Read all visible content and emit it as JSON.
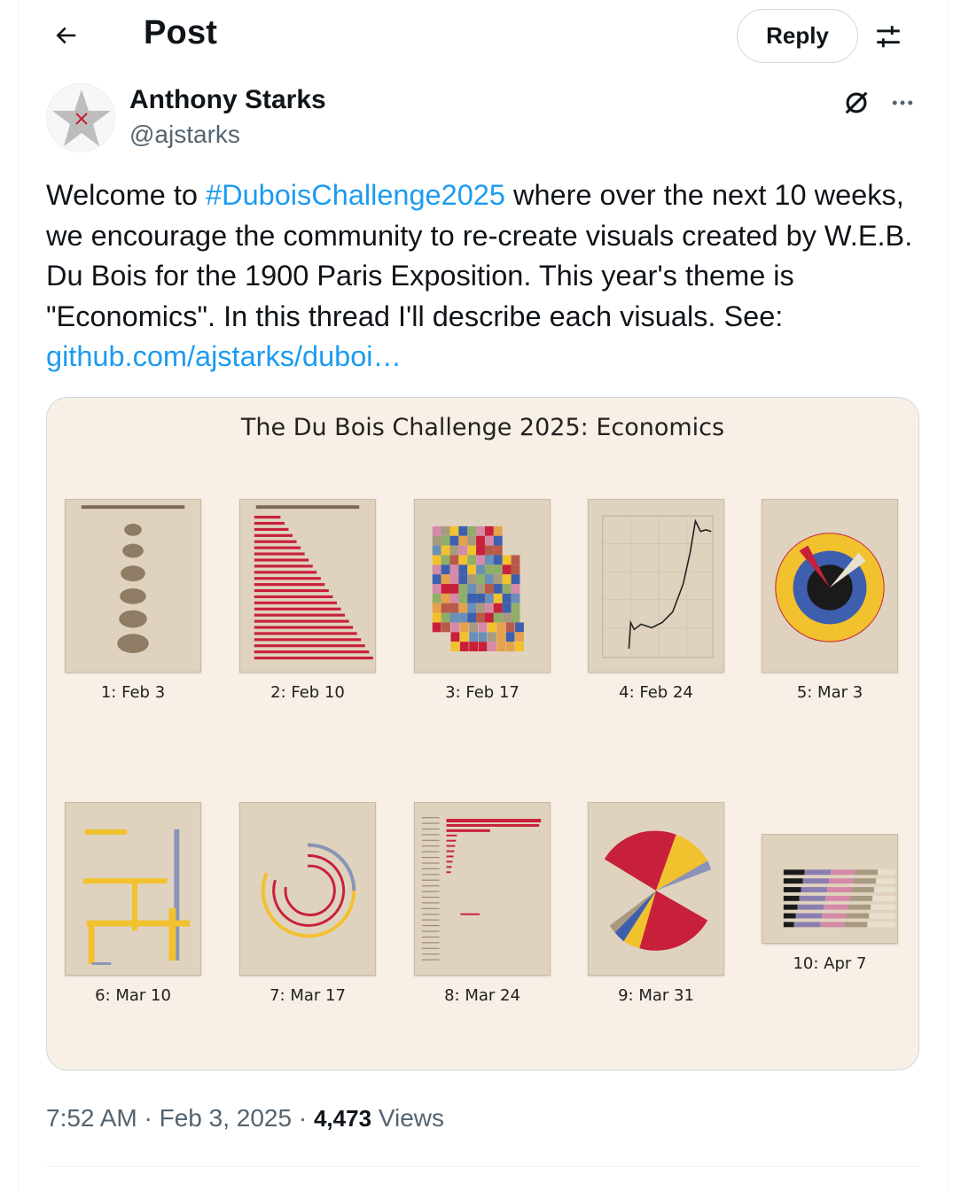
{
  "header": {
    "title": "Post",
    "reply_label": "Reply"
  },
  "author": {
    "name": "Anthony Starks",
    "handle": "@ajstarks"
  },
  "tweet": {
    "text_1": "Welcome to ",
    "hashtag": "#DuboisChallenge2025",
    "text_2": " where over the next 10 weeks, we encourage the community to re-create  visuals created by W.E.B. Du Bois for the 1900 Paris Exposition. This year's theme is \"Economics\".  In this thread I'll describe each visuals.  See: ",
    "link": "github.com/ajstarks/duboi…"
  },
  "media": {
    "title": "The Du Bois Challenge 2025: Economics",
    "thumbnails": [
      {
        "caption": "1: Feb 3"
      },
      {
        "caption": "2: Feb 10"
      },
      {
        "caption": "3: Feb 17"
      },
      {
        "caption": "4: Feb 24"
      },
      {
        "caption": "5: Mar 3"
      },
      {
        "caption": "6: Mar 10"
      },
      {
        "caption": "7: Mar 17"
      },
      {
        "caption": "8: Mar 24"
      },
      {
        "caption": "9: Mar 31"
      },
      {
        "caption": "10: Apr 7"
      }
    ]
  },
  "footer": {
    "time": "7:52 AM",
    "sep": " · ",
    "date": "Feb 3, 2025",
    "views_count": "4,473",
    "views_label": " Views"
  },
  "icons": {
    "back": "arrow-left-icon",
    "adjust": "sliders-icon",
    "grok": "grok-icon",
    "more": "more-horizontal-icon"
  },
  "colors": {
    "link": "#1d9bf0",
    "muted": "#536471",
    "du_bois_red": "#c8203a",
    "du_bois_yellow": "#f2c12e",
    "du_bois_blue": "#3e5fae"
  }
}
